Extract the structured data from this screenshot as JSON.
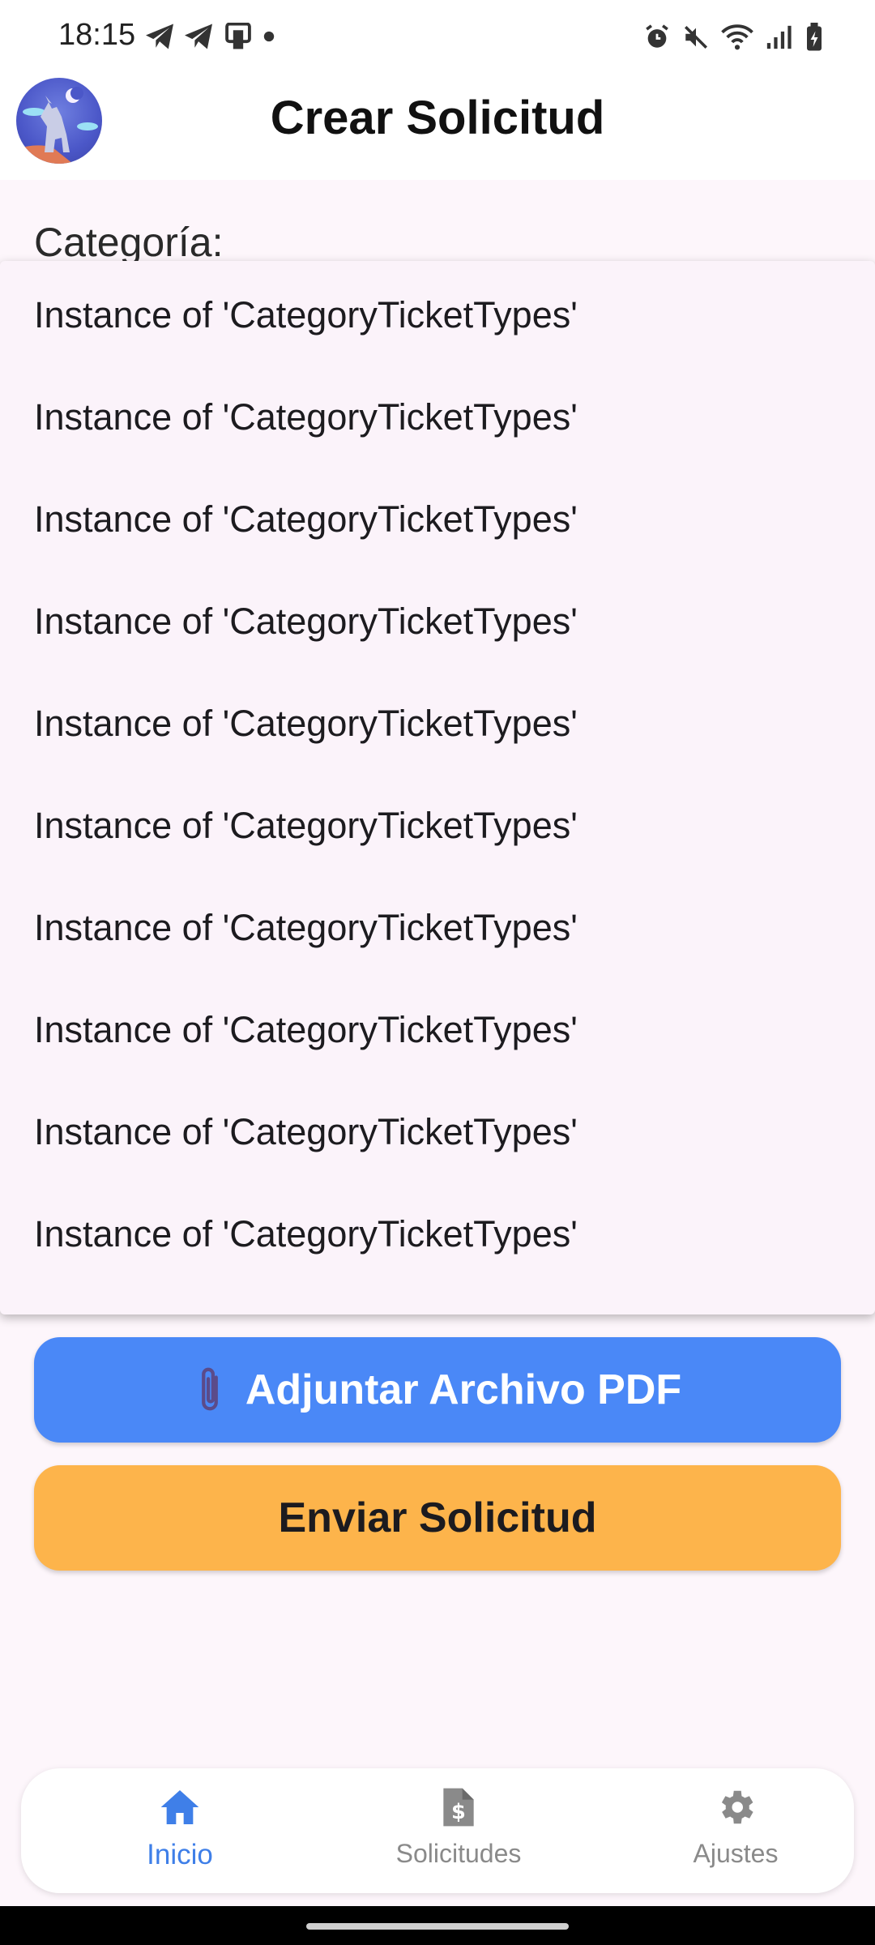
{
  "status_bar": {
    "time": "18:15",
    "left_icons": [
      "telegram-icon",
      "telegram-icon",
      "cast-icon",
      "dot-icon"
    ],
    "right_icons": [
      "alarm-icon",
      "mute-icon",
      "wifi-icon",
      "signal-icon",
      "battery-icon"
    ]
  },
  "app_bar": {
    "title": "Crear Solicitud"
  },
  "form": {
    "category_label": "Categoría:",
    "dropdown_items": [
      "Instance of 'CategoryTicketTypes'",
      "Instance of 'CategoryTicketTypes'",
      "Instance of 'CategoryTicketTypes'",
      "Instance of 'CategoryTicketTypes'",
      "Instance of 'CategoryTicketTypes'",
      "Instance of 'CategoryTicketTypes'",
      "Instance of 'CategoryTicketTypes'",
      "Instance of 'CategoryTicketTypes'",
      "Instance of 'CategoryTicketTypes'",
      "Instance of 'CategoryTicketTypes'"
    ],
    "attach_button_label": "Adjuntar Archivo PDF",
    "send_button_label": "Enviar Solicitud"
  },
  "bottom_nav": {
    "items": [
      {
        "label": "Inicio",
        "icon": "home-icon",
        "active": true
      },
      {
        "label": "Solicitudes",
        "icon": "document-dollar-icon",
        "active": false
      },
      {
        "label": "Ajustes",
        "icon": "gear-icon",
        "active": false
      }
    ]
  },
  "colors": {
    "accent_blue": "#4a88f7",
    "send_orange": "#fdb44b",
    "nav_active": "#3f7fe8",
    "background": "#fdf6fb"
  }
}
